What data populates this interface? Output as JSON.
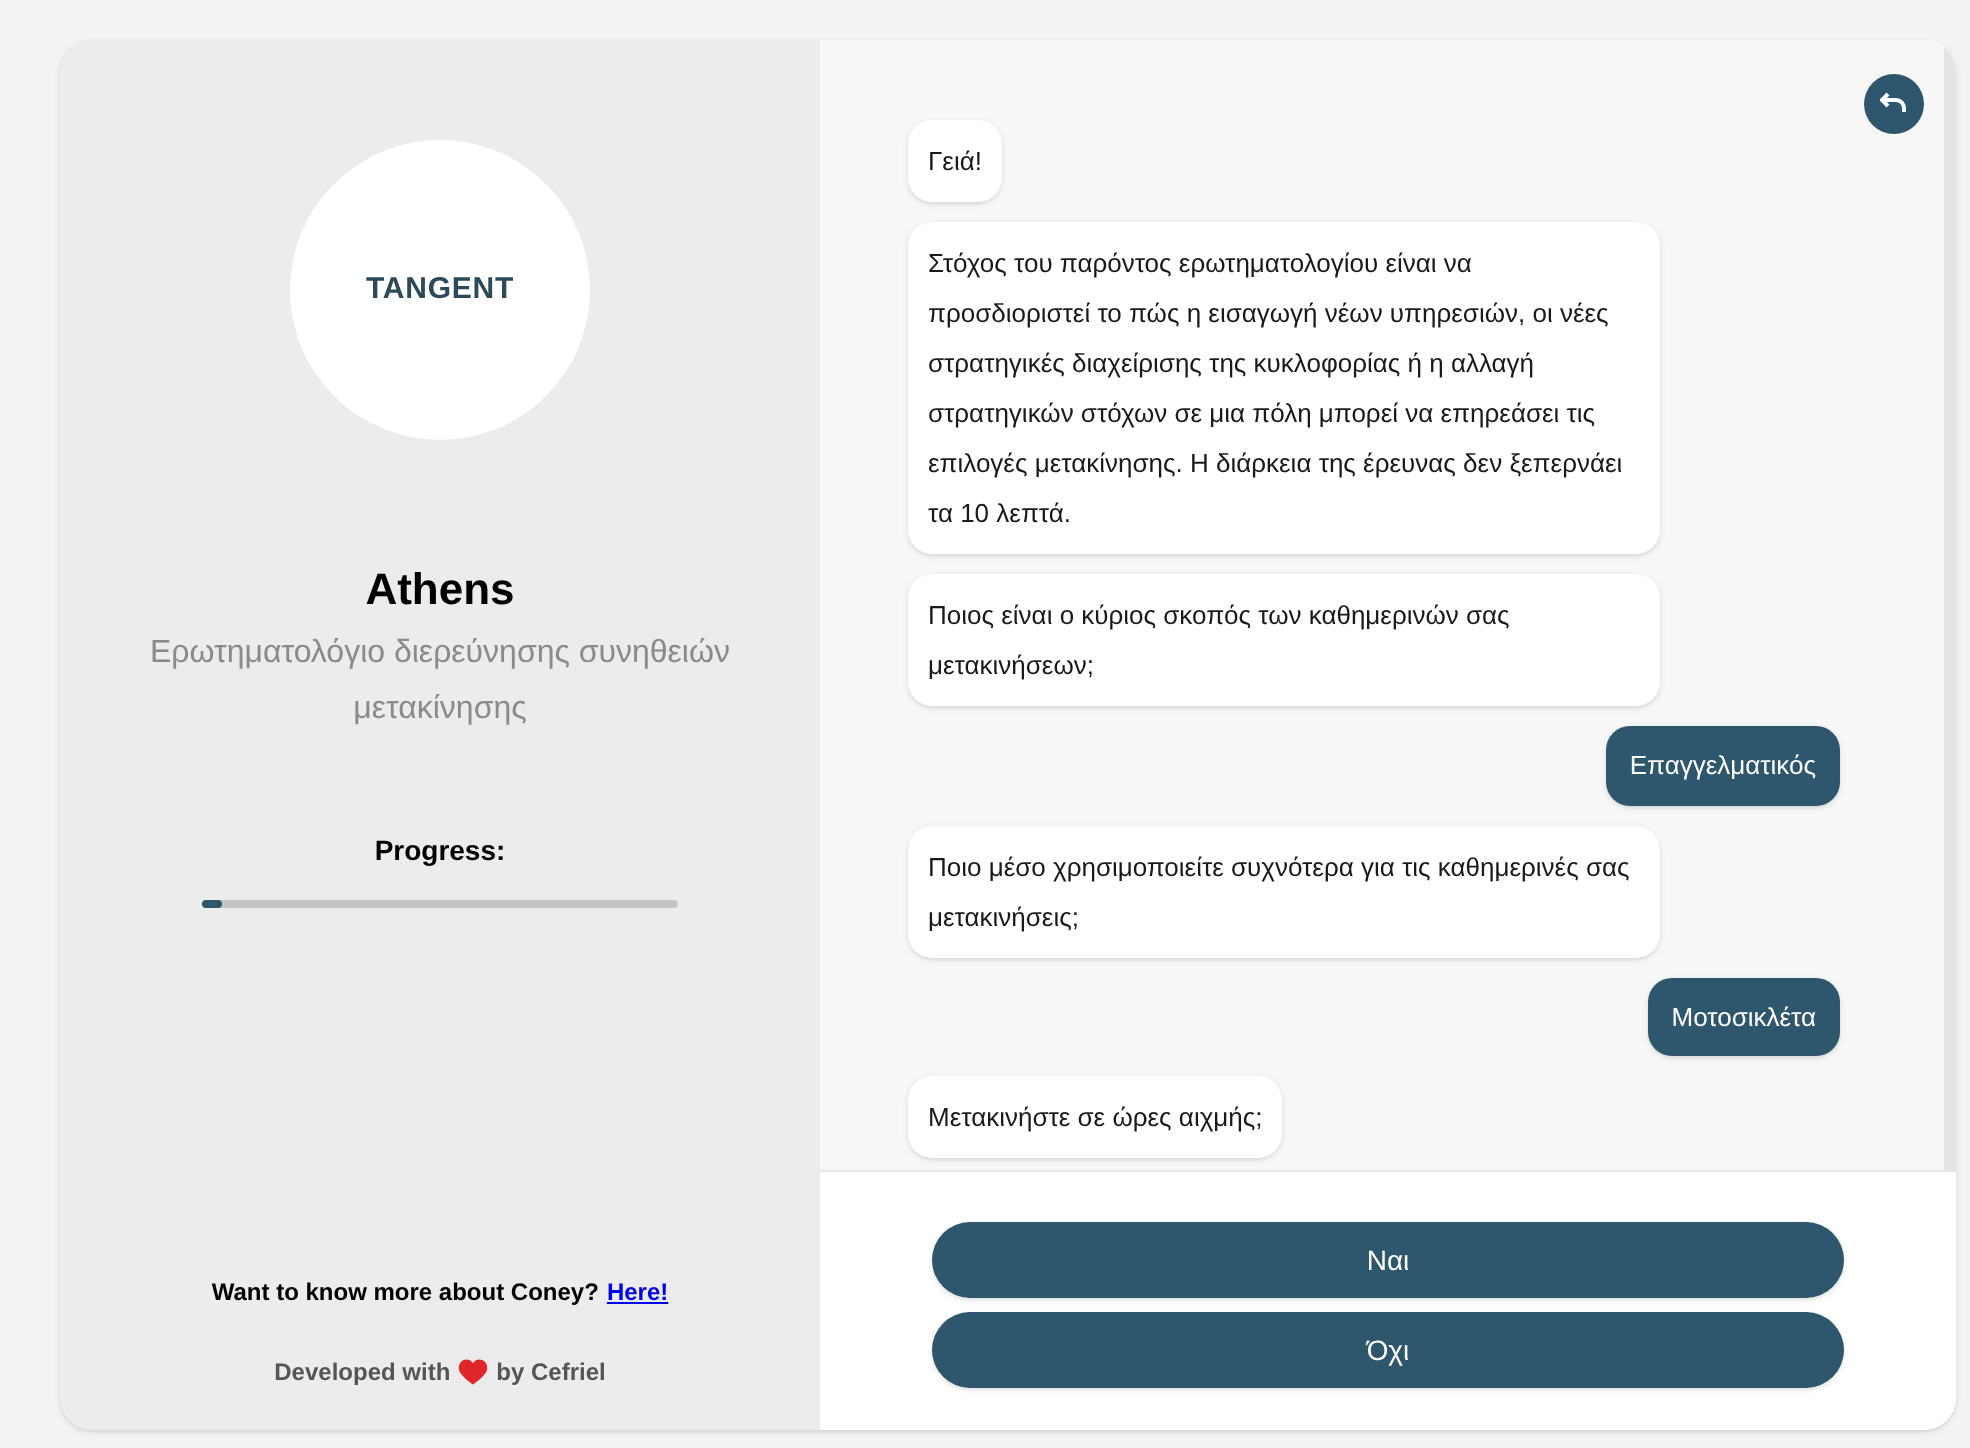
{
  "sidebar": {
    "logo": "TANGENT",
    "title": "Athens",
    "subtitle": "Ερωτηματολόγιο διερεύνησης συνηθειών μετακίνησης",
    "progress_label": "Progress:",
    "progress": {
      "level": 0.04
    },
    "more_info": "Want to know more about Coney?",
    "more_link": "Here!",
    "credit_before": "Developed with",
    "credit_after": "by Cefriel"
  },
  "messages": [
    {
      "kind": "bot",
      "text": "Γειά!"
    },
    {
      "kind": "bot",
      "text": "Στόχος του παρόντος ερωτηματολογίου είναι να προσδιοριστεί το πώς η εισαγωγή νέων υπηρεσιών, οι νέες\nστρατηγικές διαχείρισης της κυκλοφορίας ή η αλλαγή στρατηγικών στόχων σε μια πόλη μπορεί να επηρεάσει τις επιλογές μετακίνησης. Η διάρκεια της έρευνας δεν ξεπερνάει τα 10 λεπτά."
    },
    {
      "kind": "bot",
      "text": "Ποιος είναι ο κύριος σκοπός των καθημερινών σας μετακινήσεων;"
    },
    {
      "kind": "user",
      "text": "Επαγγελματικός"
    },
    {
      "kind": "bot",
      "text": "Ποιο μέσο χρησιμοποιείτε συχνότερα για τις καθημερινές σας μετακινήσεις;"
    },
    {
      "kind": "user",
      "text": "Μοτοσικλέτα"
    },
    {
      "kind": "bot",
      "text": "Μετακινήστε σε ώρες αιχμής;"
    }
  ],
  "answers": [
    "Ναι",
    "Όχι"
  ]
}
